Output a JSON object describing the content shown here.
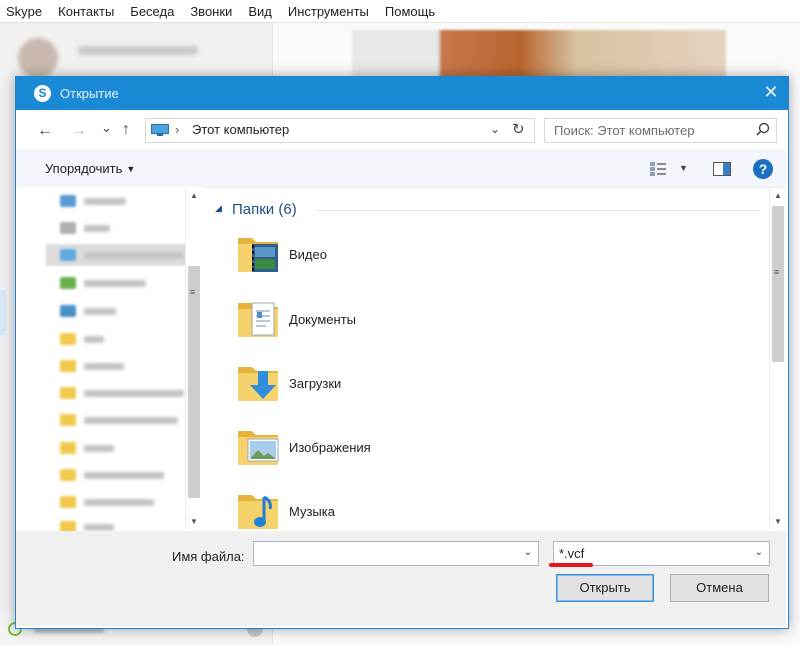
{
  "menubar": {
    "items": [
      "Skype",
      "Контакты",
      "Беседа",
      "Звонки",
      "Вид",
      "Инструменты",
      "Помощь"
    ]
  },
  "dialog": {
    "title": "Открытие",
    "app_icon_letter": "S",
    "close_glyph": "✕",
    "nav": {
      "back": "←",
      "forward": "→",
      "recent": "⌄",
      "up": "↑"
    },
    "address": {
      "separator": "›",
      "path": "Этот компьютер",
      "dropdown": "⌄",
      "refresh": "↻"
    },
    "search": {
      "placeholder": "Поиск: Этот компьютер"
    },
    "toolbar": {
      "organize_label": "Упорядочить",
      "organize_caret": "▼",
      "view_caret": "▼",
      "help_glyph": "?"
    },
    "group": {
      "caret": "◢",
      "title": "Папки (6)"
    },
    "folders": [
      {
        "label": "Видео",
        "icon": "video-folder-icon"
      },
      {
        "label": "Документы",
        "icon": "documents-folder-icon"
      },
      {
        "label": "Загрузки",
        "icon": "downloads-folder-icon"
      },
      {
        "label": "Изображения",
        "icon": "pictures-folder-icon"
      },
      {
        "label": "Музыка",
        "icon": "music-folder-icon"
      }
    ],
    "filename": {
      "label": "Имя файла:",
      "value": "",
      "dropdown": "⌄"
    },
    "filetype": {
      "value": "*.vcf",
      "dropdown": "⌄"
    },
    "buttons": {
      "open": "Открыть",
      "cancel": "Отмена"
    },
    "scroll": {
      "up": "▲",
      "down": "▼",
      "grip": "≡"
    }
  },
  "colors": {
    "titlebar": "#1a89d6",
    "group_title": "#1e4e8c",
    "annotation_underline": "#e8151a",
    "folder_yellow": "#f2c94c"
  }
}
